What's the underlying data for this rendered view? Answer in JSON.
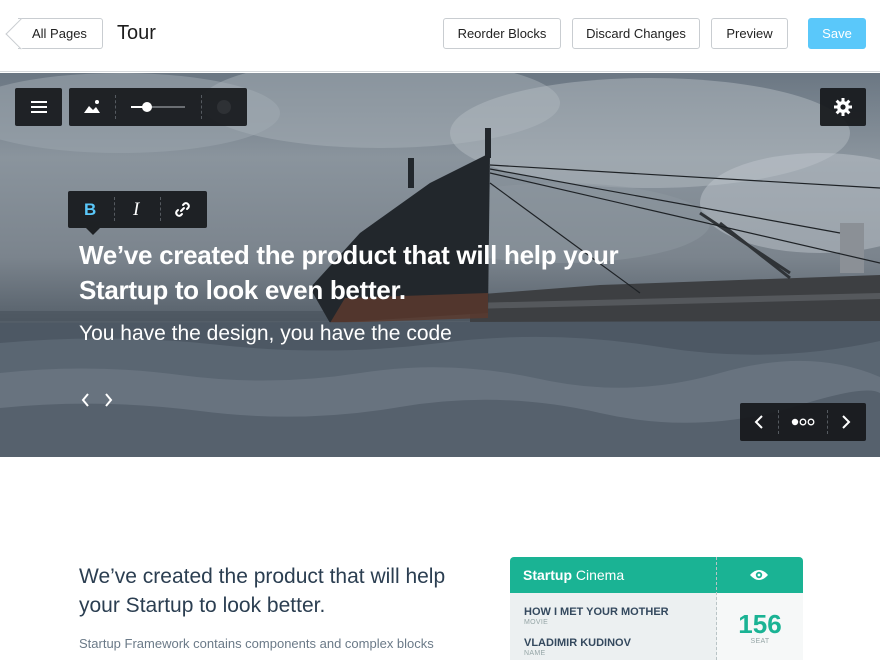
{
  "topbar": {
    "back_label": "All Pages",
    "title": "Tour",
    "reorder_label": "Reorder Blocks",
    "discard_label": "Discard Changes",
    "preview_label": "Preview",
    "save_label": "Save"
  },
  "hero": {
    "heading": "We’ve created the product that will help your Startup to look even better.",
    "subheading": "You have the design, you have the code",
    "format_tools": {
      "bold": "B",
      "italic": "I"
    }
  },
  "content": {
    "title": "We’ve created the product that will help your Startup to look better.",
    "text": "Startup Framework contains components and complex blocks"
  },
  "cinema_card": {
    "brand_bold": "Startup",
    "brand_rest": "Cinema",
    "movie": "HOW I MET YOUR MOTHER",
    "movie_label": "MOVIE",
    "name": "VLADIMIR KUDINOV",
    "name_label": "NAME",
    "seat": "156",
    "seat_label": "SEAT"
  },
  "colors": {
    "save_button": "#5ac8fa",
    "accent_green": "#1ab394",
    "bold_active": "#5ac8fa"
  },
  "icons": [
    "back-arrow",
    "hamburger-icon",
    "image-icon",
    "brightness-slider",
    "color-dot",
    "gear-icon",
    "bold-icon",
    "italic-icon",
    "link-icon",
    "prev-arrow",
    "next-arrow",
    "dots-icon",
    "eye-icon"
  ]
}
